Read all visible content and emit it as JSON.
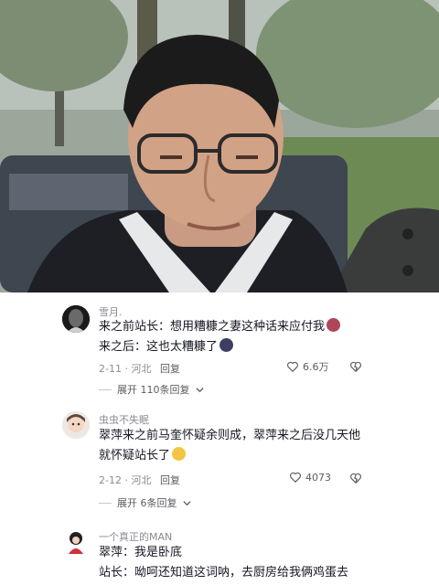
{
  "comments": [
    {
      "username": "雪月.",
      "lines": [
        "来之前站长：想用糟糠之妻这种话来应付我",
        "来之后：这也太糟糠了"
      ],
      "date": "2-11",
      "location": "河北",
      "reply_label": "回复",
      "likes": "6.6万",
      "expand_label": "展开 110条回复"
    },
    {
      "username": "虫虫不失眠",
      "lines": [
        "翠萍来之前马奎怀疑余则成，翠萍来之后没几天他",
        "就怀疑站长了"
      ],
      "date": "2-12",
      "location": "河北",
      "reply_label": "回复",
      "likes": "4073",
      "expand_label": "展开 6条回复"
    },
    {
      "username": "一个真正的MAN",
      "lines": [
        "翠萍：我是卧底",
        "站长：呦呵还知道这词呐，去厨房给我俩鸡蛋去"
      ]
    }
  ],
  "icons": {
    "heart": "heart-outline-icon",
    "dislike": "broken-heart-icon",
    "chevron": "chevron-down-icon"
  }
}
